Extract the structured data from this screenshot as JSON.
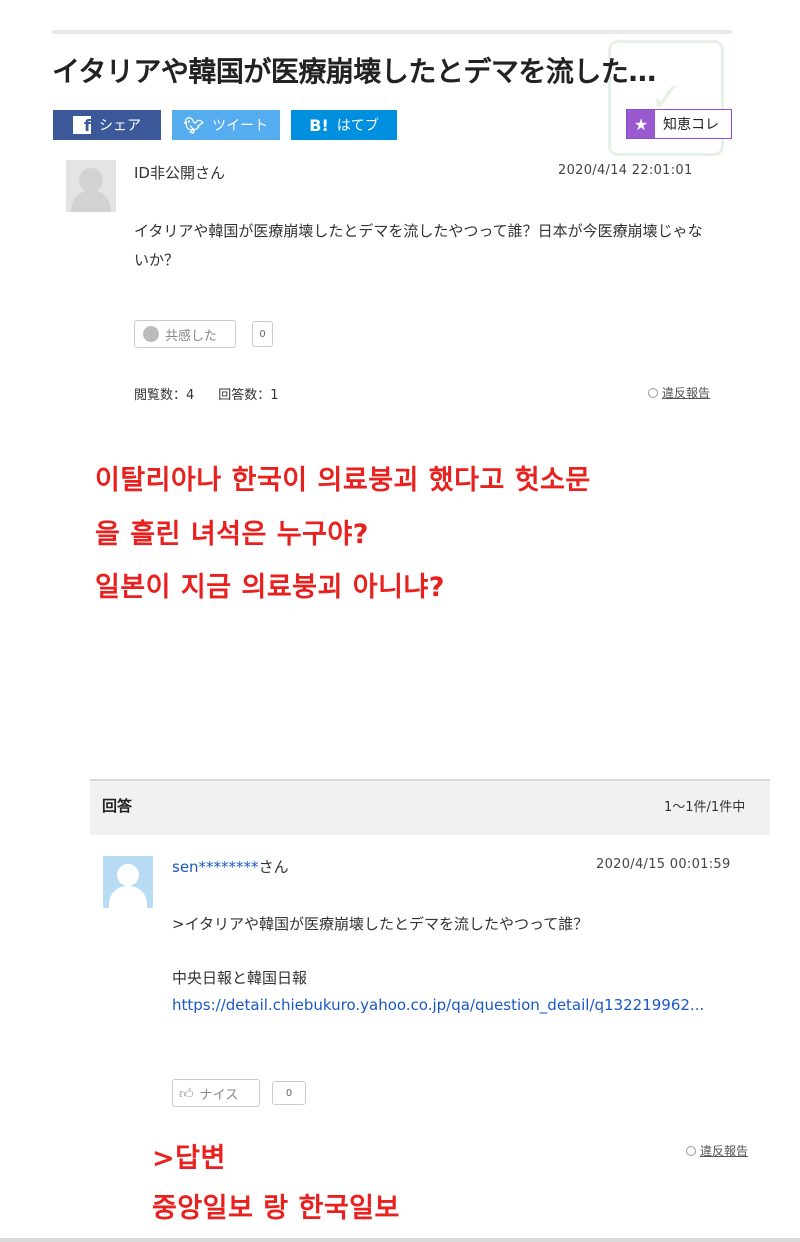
{
  "question": {
    "title": "イタリアや韓国が医療崩壊したとデマを流した…",
    "share_buttons": {
      "facebook": "シェア",
      "twitter": "ツイート",
      "hatena_icon": "B!",
      "hatena": "はてブ"
    },
    "chiekore": "知恵コレ",
    "author": "ID非公開さん",
    "date": "2020/4/14  22:01:01",
    "body": "イタリアや韓国が医療崩壊したとデマを流したやつって誰？日本が今医療崩壊じゃないか？",
    "empathy_label": "共感した",
    "empathy_count": "0",
    "views": "閲覧数：4",
    "answers": "回答数：1",
    "report": "違反報告"
  },
  "korean_overlay": {
    "line1": "이탈리아나 한국이 의료붕괴 했다고 헛소문",
    "line2": "을 흘린 녀석은 누구야?",
    "line3": "일본이 지금 의료붕괴 아니냐?",
    "answer_label": ">답변",
    "answer_text": "중앙일보 랑  한국일보"
  },
  "answers_section": {
    "title": "回答",
    "range": "1〜1件/1件中"
  },
  "answer": {
    "author_link": "sen********",
    "author_suffix": "さん",
    "date": "2020/4/15  00:01:59",
    "quote": ">イタリアや韓国が医療崩壊したとデマを流したやつって誰？",
    "text": "中央日報と韓国日報",
    "link": "https://detail.chiebukuro.yahoo.co.jp/qa/question_detail/q132219962...",
    "nice_label": "ナイス",
    "nice_count": "0",
    "report": "違反報告"
  },
  "colors": {
    "facebook": "#3b5998",
    "twitter": "#55acee",
    "hatena": "#008fde",
    "chiekore_accent": "#9b59d0",
    "overlay_red": "#e8211f",
    "link_blue": "#1a58c8"
  },
  "icons": [
    "facebook-icon",
    "twitter-icon",
    "hatena-icon",
    "star-icon",
    "smile-icon",
    "thumbs-up-icon",
    "report-icon"
  ]
}
